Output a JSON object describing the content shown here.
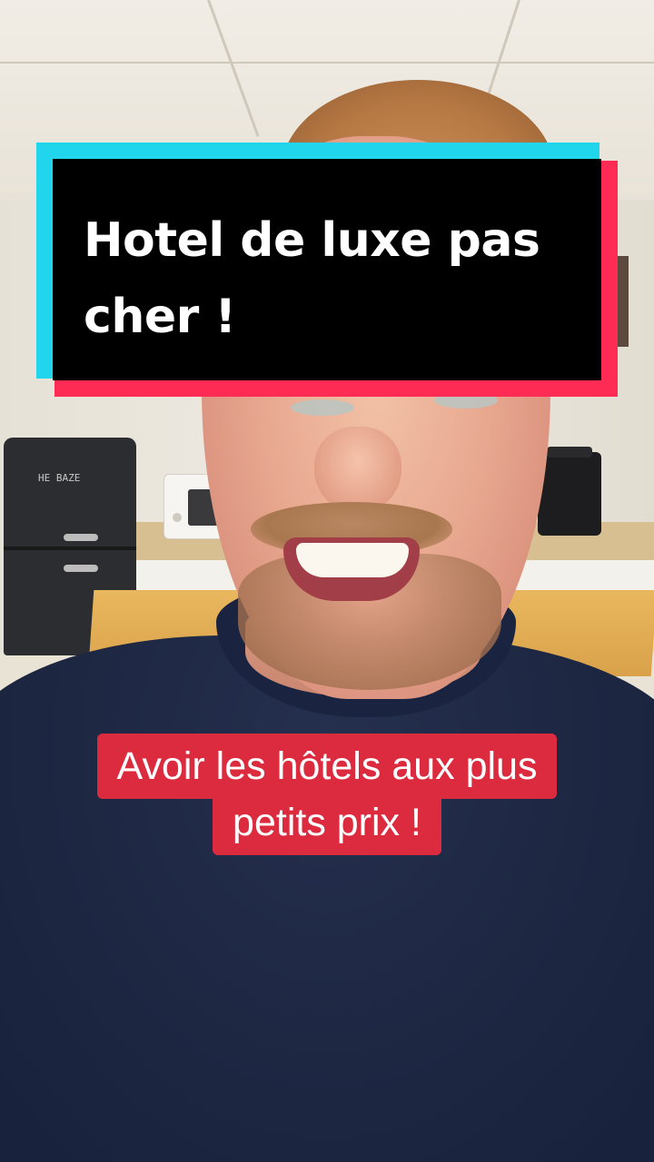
{
  "overlay": {
    "title": "Hotel de luxe pas cher !",
    "caption_line_1": "Avoir les hôtels aux plus",
    "caption_line_2": "petits prix !"
  },
  "scene": {
    "fridge_brand": "HE BAZE"
  },
  "colors": {
    "title_box": "#000000",
    "title_text": "#ffffff",
    "title_shadow_cyan": "#20d5ec",
    "title_shadow_red": "#fe2c55",
    "caption_bg": "#dc2b3e",
    "caption_text": "#ffffff"
  }
}
